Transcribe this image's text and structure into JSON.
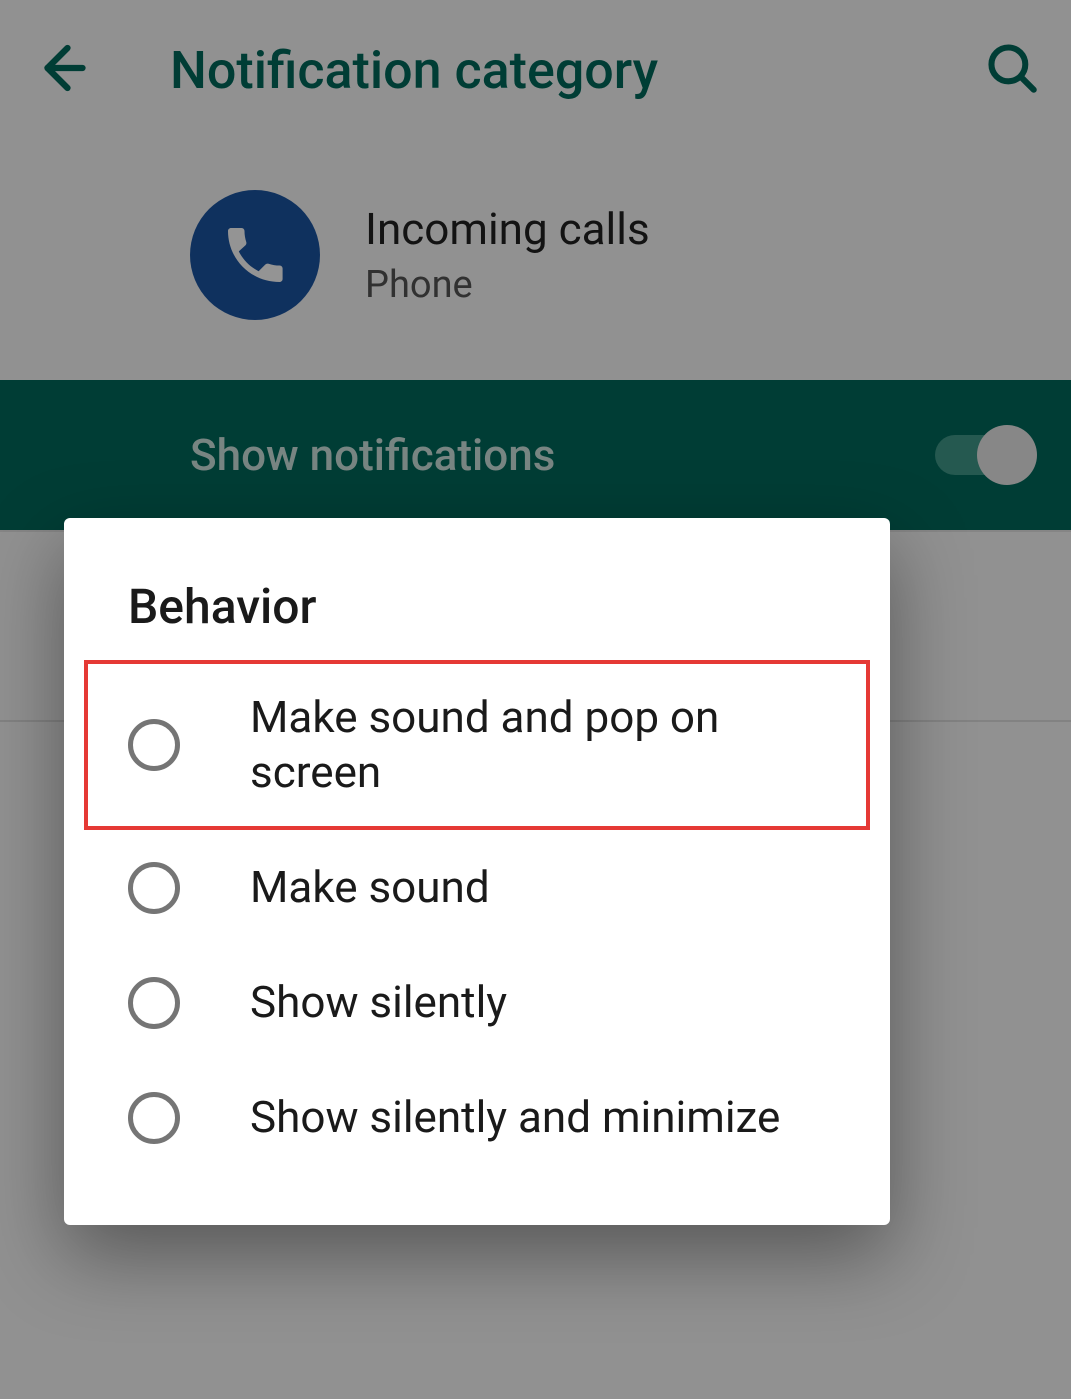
{
  "header": {
    "title": "Notification category"
  },
  "app": {
    "name": "Incoming calls",
    "category": "Phone"
  },
  "toggle": {
    "label": "Show notifications",
    "on": true
  },
  "dialog": {
    "title": "Behavior",
    "options": [
      "Make sound and pop on screen",
      "Make sound",
      "Show silently",
      "Show silently and minimize"
    ],
    "highlightedIndex": 0
  },
  "colors": {
    "accent": "#00695c",
    "appIcon": "#1b55a3",
    "highlight": "#e53935"
  }
}
